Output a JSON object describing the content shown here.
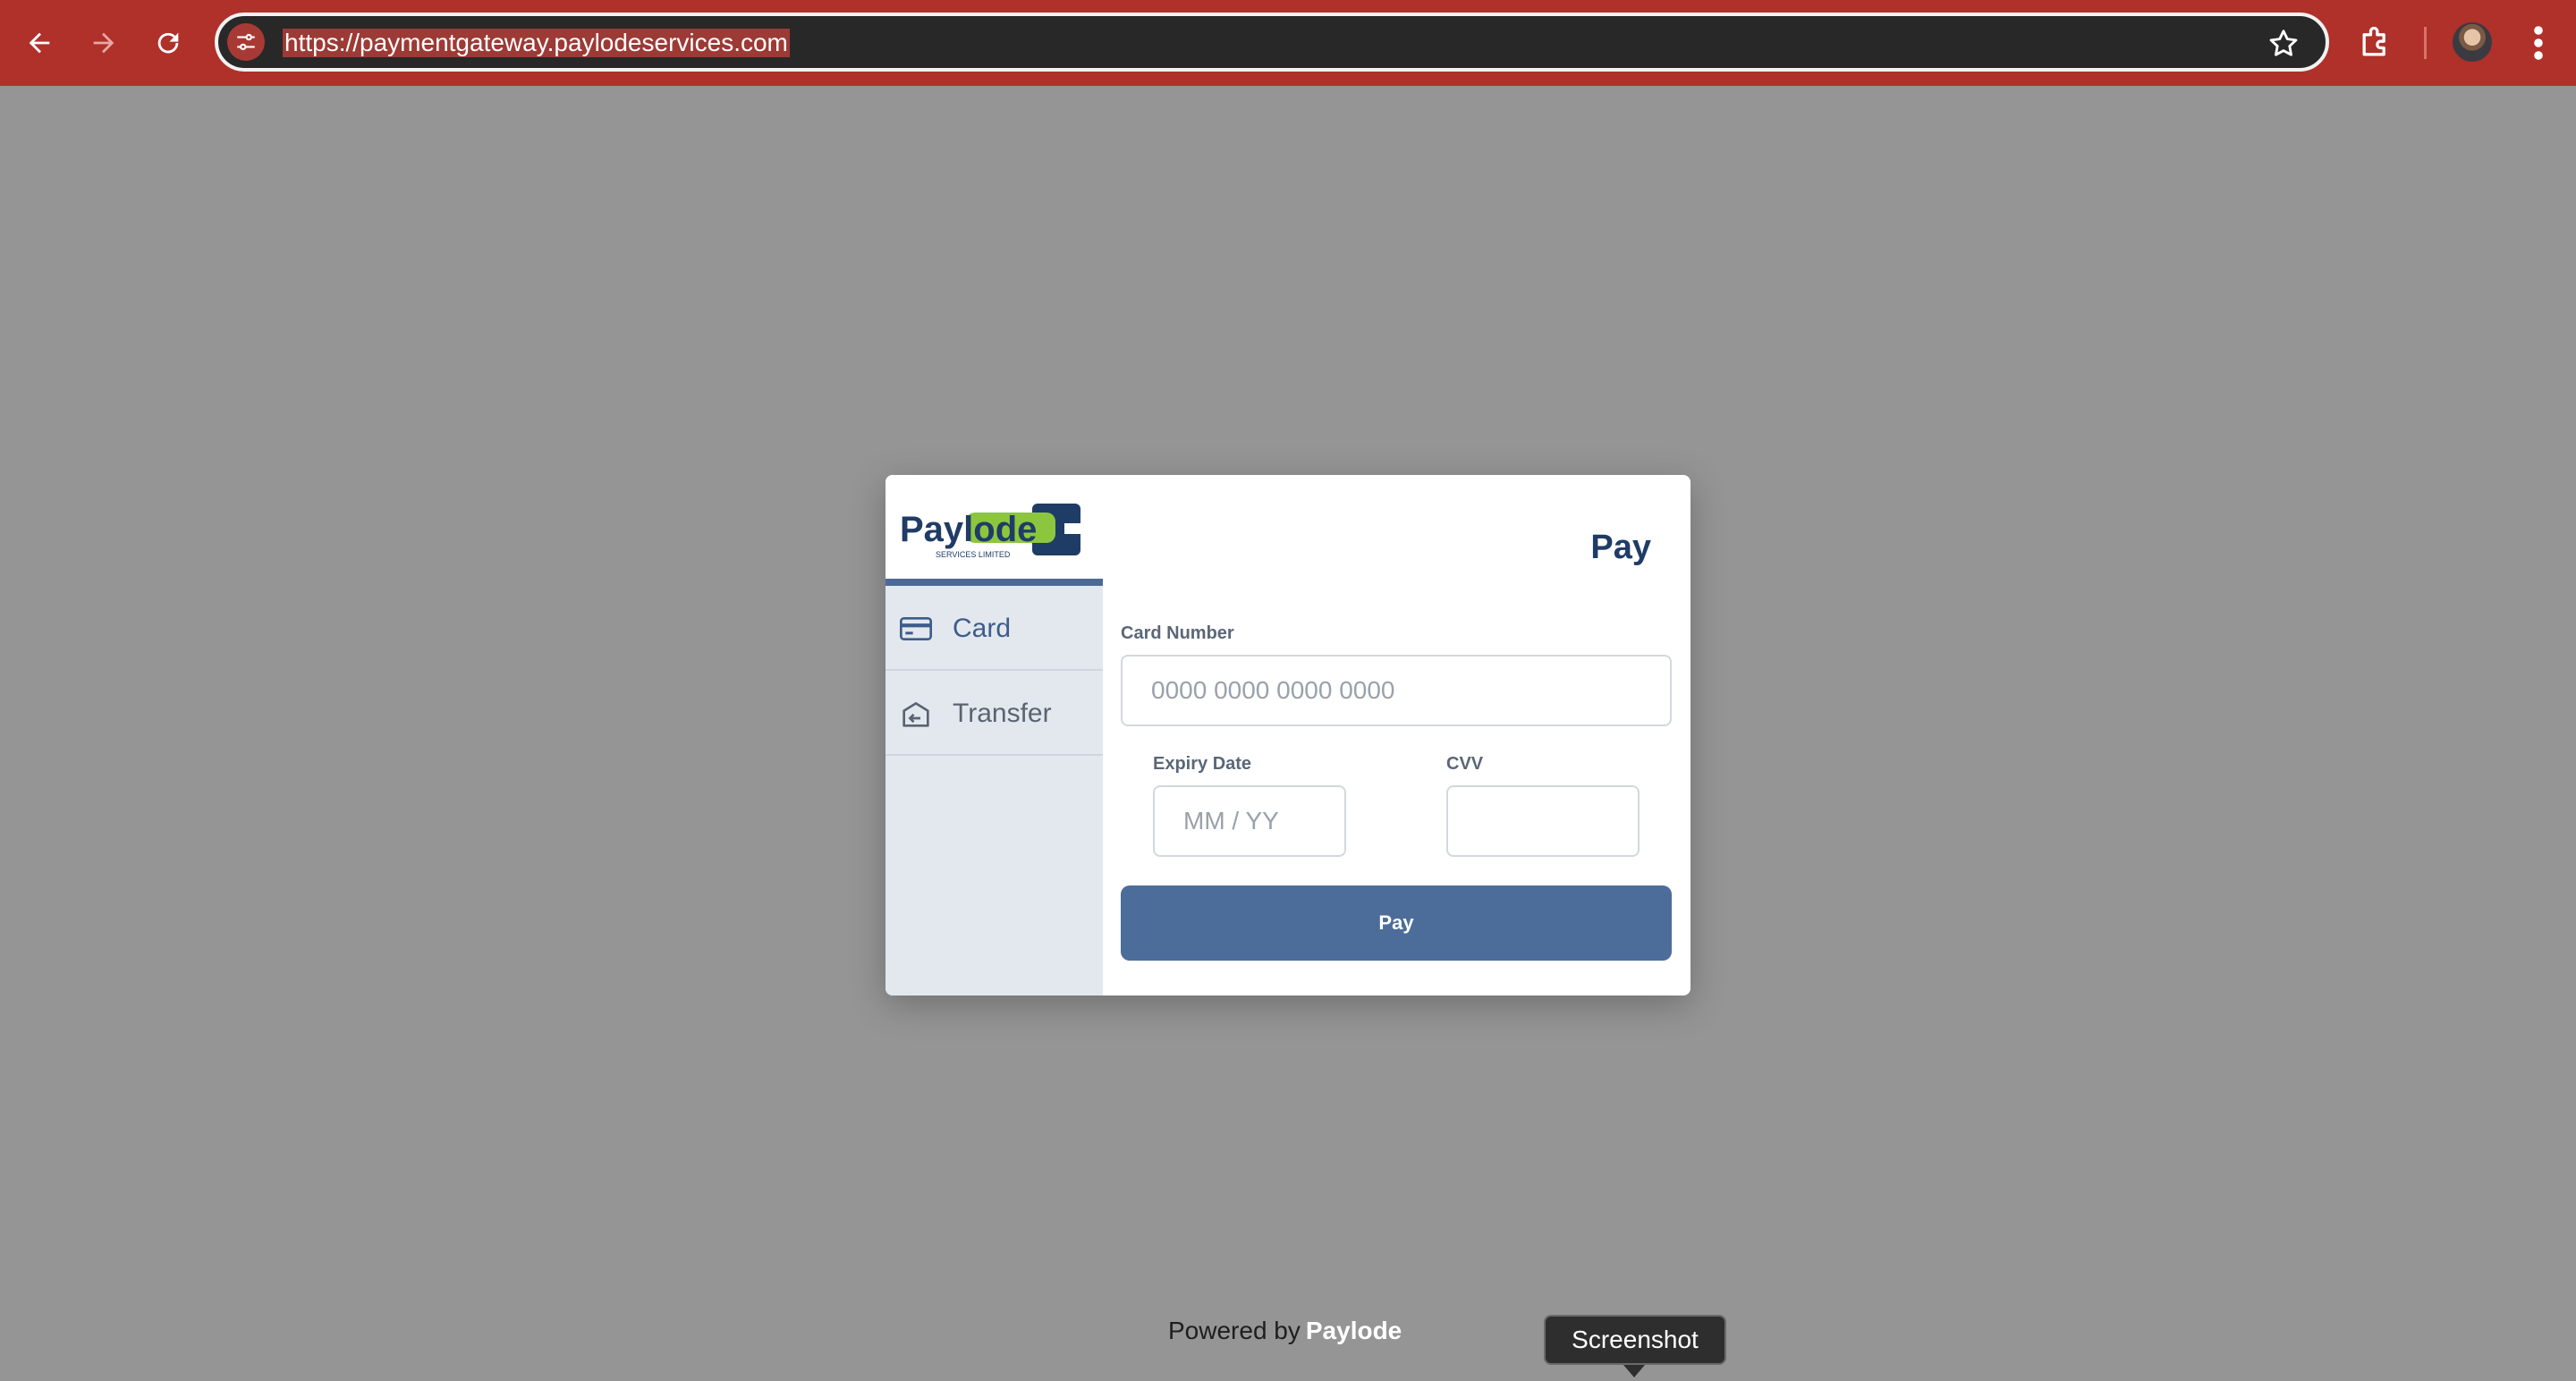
{
  "browser": {
    "url": "https://paymentgateway.paylodeservices.com",
    "icons": {
      "back": "arrow-left-icon",
      "forward": "arrow-right-icon",
      "reload": "reload-icon",
      "site_info": "tune-icon",
      "bookmark": "star-icon",
      "extensions": "puzzle-icon",
      "menu": "kebab-icon"
    }
  },
  "brand": {
    "logo_main": "Paylode",
    "logo_sub": "SERVICES LIMITED",
    "colors": {
      "navy": "#1f3c66",
      "green": "#8cc63f",
      "accent": "#4c6d9a"
    }
  },
  "sidebar": {
    "items": [
      {
        "label": "Card",
        "icon": "credit-card-icon",
        "active": true
      },
      {
        "label": "Transfer",
        "icon": "bank-transfer-icon",
        "active": false
      }
    ]
  },
  "form": {
    "title": "Pay",
    "card_number": {
      "label": "Card Number",
      "placeholder": "0000 0000 0000 0000",
      "value": ""
    },
    "expiry": {
      "label": "Expiry Date",
      "placeholder": "MM / YY",
      "value": ""
    },
    "cvv": {
      "label": "CVV",
      "placeholder": "",
      "value": ""
    },
    "submit_label": "Pay"
  },
  "footer": {
    "powered_prefix": "Powered by",
    "powered_brand": "Paylode"
  },
  "tooltip": {
    "text": "Screenshot"
  }
}
